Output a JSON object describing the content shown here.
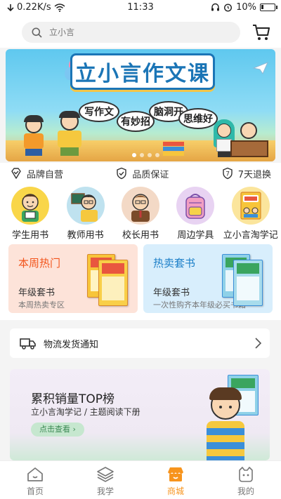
{
  "status_bar": {
    "speed": "0.22K/s",
    "time": "11:33",
    "battery": "10%"
  },
  "search": {
    "placeholder": "立小言"
  },
  "banner": {
    "title": "立小言作文课",
    "bubbles": [
      "写作文",
      "有妙招",
      "脑洞开",
      "思维好"
    ],
    "slide_count": 4,
    "active_slide": 1
  },
  "guarantees": [
    {
      "label": "品牌自营",
      "icon": "diamond-check-icon"
    },
    {
      "label": "品质保证",
      "icon": "shield-check-icon"
    },
    {
      "label": "7天退换",
      "icon": "seven-day-return-icon"
    }
  ],
  "categories": [
    {
      "label": "学生用书",
      "icon": "student-icon",
      "color": "#f9d649"
    },
    {
      "label": "教师用书",
      "icon": "teacher-icon",
      "color": "#bfe2ef"
    },
    {
      "label": "校长用书",
      "icon": "principal-icon",
      "color": "#f3d9c6"
    },
    {
      "label": "周边学具",
      "icon": "backpack-icon",
      "color": "#e8d3f2"
    },
    {
      "label": "立小言淘学记",
      "icon": "book-cover-icon",
      "color": "#fbe59c"
    }
  ],
  "promos": {
    "left": {
      "title": "本周热门",
      "sub": "年级套书",
      "desc": "本周热卖专区",
      "color": "#f2541b"
    },
    "right": {
      "title": "热卖套书",
      "sub": "年级套书",
      "desc": "一次性购齐本年级必买书籍",
      "color": "#1c7fc8"
    }
  },
  "notice": {
    "label": "物流发货通知"
  },
  "toplist": {
    "title": "累积销量TOP榜",
    "subtitle": "立小言淘学记 / 主题阅读下册",
    "button": "点击查看"
  },
  "tabbar": [
    {
      "label": "首页",
      "icon": "home-icon",
      "active": false
    },
    {
      "label": "我学",
      "icon": "layers-icon",
      "active": false
    },
    {
      "label": "商城",
      "icon": "shop-icon",
      "active": true
    },
    {
      "label": "我的",
      "icon": "profile-face-icon",
      "active": false
    }
  ],
  "colors": {
    "accent": "#f7941d",
    "brand_blue": "#1b75b6"
  }
}
